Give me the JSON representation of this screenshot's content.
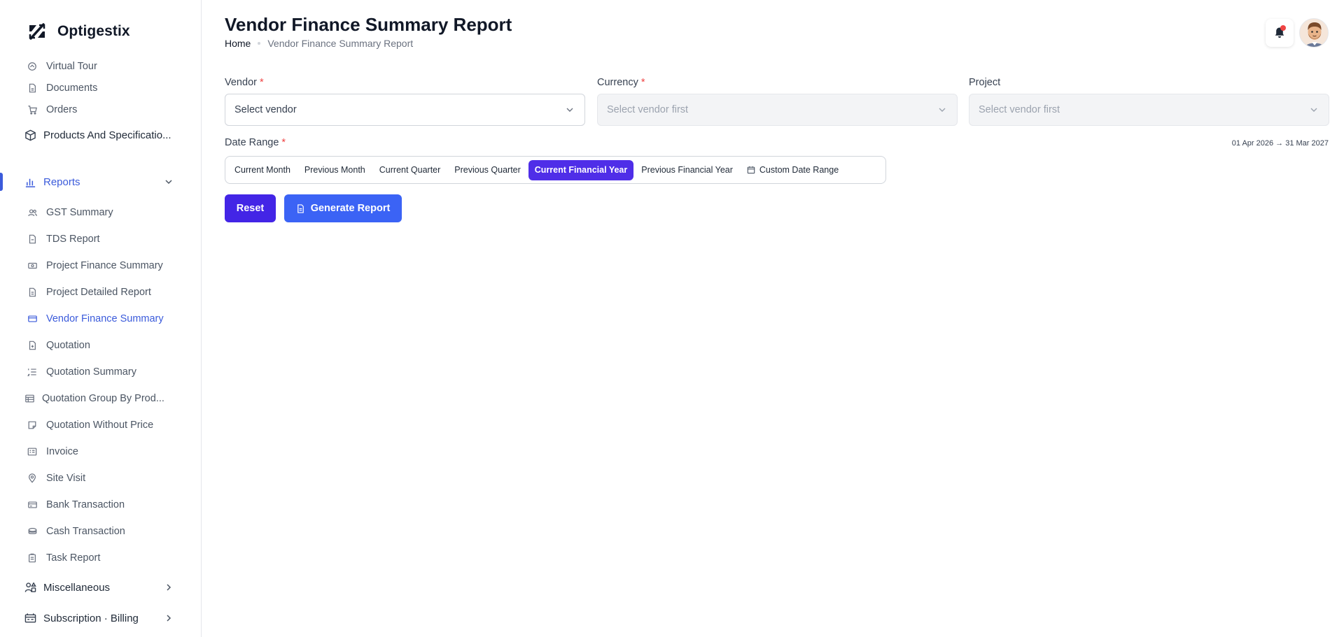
{
  "app": {
    "name": "Optigestix"
  },
  "sidebar": {
    "items_top": [
      {
        "label": "Virtual Tour"
      },
      {
        "label": "Documents"
      },
      {
        "label": "Orders"
      }
    ],
    "products": {
      "label": "Products And Specificatio..."
    },
    "reports": {
      "label": "Reports"
    },
    "report_items": [
      {
        "label": "GST Summary"
      },
      {
        "label": "TDS Report"
      },
      {
        "label": "Project Finance Summary"
      },
      {
        "label": "Project Detailed Report"
      },
      {
        "label": "Vendor Finance Summary"
      },
      {
        "label": "Quotation"
      },
      {
        "label": "Quotation Summary"
      },
      {
        "label": "Quotation Group By Prod..."
      },
      {
        "label": "Quotation Without Price"
      },
      {
        "label": "Invoice"
      },
      {
        "label": "Site Visit"
      },
      {
        "label": "Bank Transaction"
      },
      {
        "label": "Cash Transaction"
      },
      {
        "label": "Task Report"
      }
    ],
    "misc": {
      "label": "Miscellaneous"
    },
    "billing": {
      "label": "Subscription · Billing"
    }
  },
  "header": {
    "title": "Vendor Finance Summary Report",
    "breadcrumb_home": "Home",
    "breadcrumb_current": "Vendor Finance Summary Report"
  },
  "form": {
    "vendor": {
      "label": "Vendor",
      "required": "*",
      "placeholder": "Select vendor"
    },
    "currency": {
      "label": "Currency",
      "required": "*",
      "placeholder": "Select vendor first"
    },
    "project": {
      "label": "Project",
      "placeholder": "Select vendor first"
    },
    "date_range": {
      "label": "Date Range",
      "required": "*",
      "display": "01 Apr 2026 → 31 Mar 2027",
      "options": [
        {
          "label": "Current Month"
        },
        {
          "label": "Previous Month"
        },
        {
          "label": "Current Quarter"
        },
        {
          "label": "Previous Quarter"
        },
        {
          "label": "Current Financial Year"
        },
        {
          "label": "Previous Financial Year"
        },
        {
          "label": "Custom Date Range"
        }
      ],
      "selected": "Current Financial Year"
    },
    "reset_label": "Reset",
    "generate_label": "Generate Report"
  },
  "colors": {
    "accent": "#3b5bdb",
    "primary_button": "#4325e6",
    "generate_button": "#3b63f5",
    "selected_range": "#4f2ee8",
    "notification_badge": "#ef4444"
  }
}
